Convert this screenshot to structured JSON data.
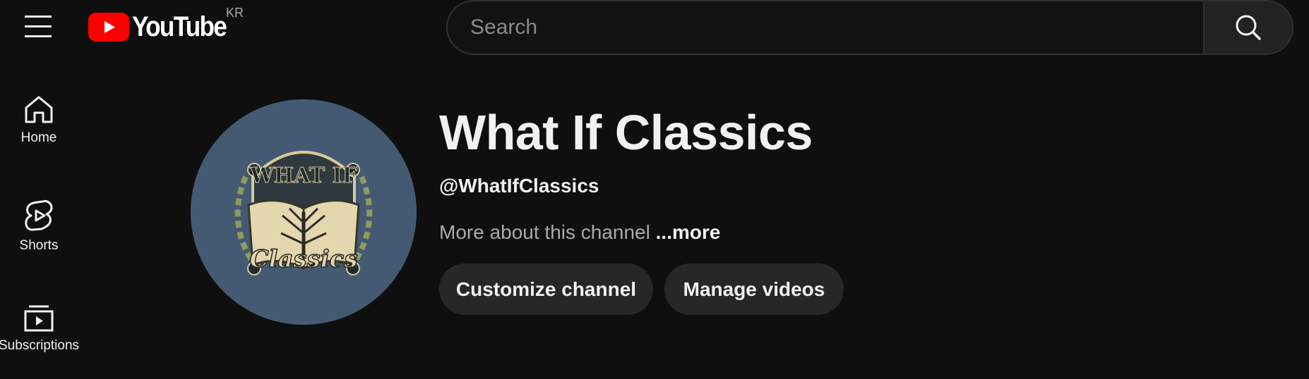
{
  "header": {
    "logo_text": "YouTube",
    "country_code": "KR",
    "search_placeholder": "Search",
    "icons": [
      "menu-icon",
      "youtube-logo-icon",
      "search-icon"
    ]
  },
  "sidebar": {
    "items": [
      {
        "label": "Home",
        "icon": "home-icon"
      },
      {
        "label": "Shorts",
        "icon": "shorts-icon"
      },
      {
        "label": "Subscriptions",
        "icon": "subscriptions-icon"
      }
    ]
  },
  "channel": {
    "name": "What If Classics",
    "handle": "@WhatIfClassics",
    "description": "More about this channel",
    "more_label": "...more",
    "avatar_text_top": "WHAT IF",
    "avatar_text_bottom": "Classics",
    "buttons": {
      "customize": "Customize channel",
      "manage": "Manage videos"
    }
  },
  "colors": {
    "background": "#0f0f0f",
    "brand_red": "#ff0000",
    "button_bg": "#272727",
    "avatar_bg": "#435a72"
  }
}
